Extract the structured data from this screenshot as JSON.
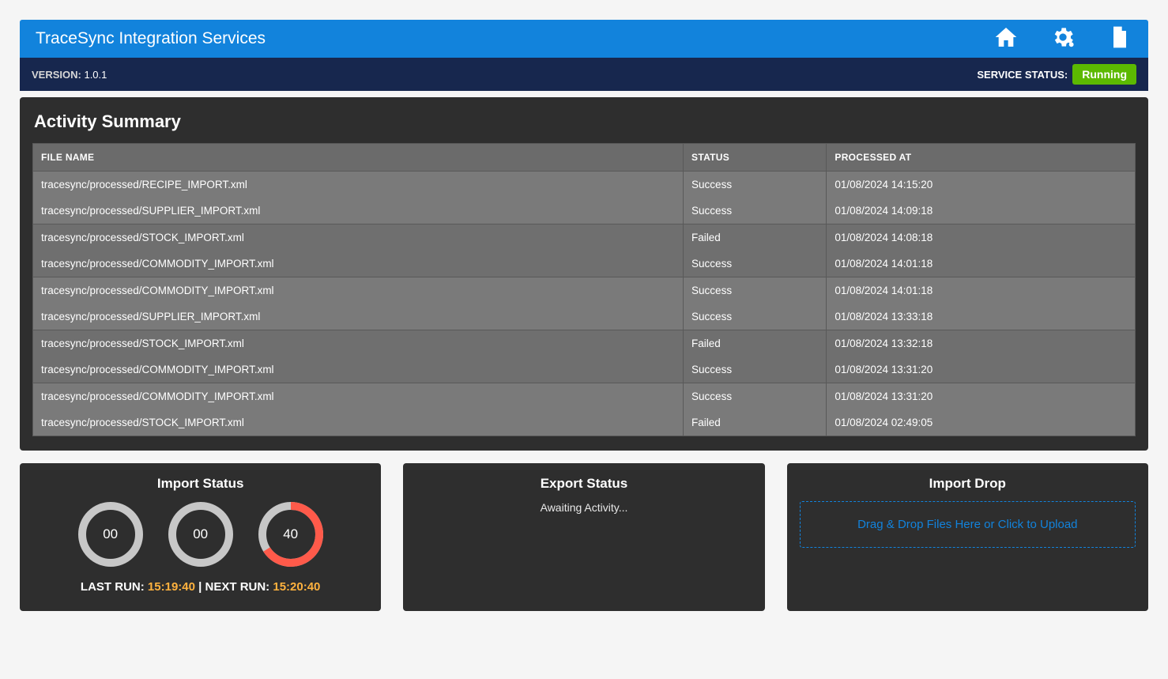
{
  "header": {
    "title": "TraceSync Integration Services",
    "icons": [
      "home",
      "settings",
      "document"
    ]
  },
  "subheader": {
    "version_label": "VERSION:",
    "version_value": "1.0.1",
    "status_label": "SERVICE STATUS:",
    "status_value": "Running"
  },
  "activity": {
    "title": "Activity Summary",
    "columns": {
      "file": "FILE NAME",
      "status": "STATUS",
      "processed": "PROCESSED AT"
    },
    "rows": [
      {
        "file": "tracesync/processed/RECIPE_IMPORT.xml",
        "status": "Success",
        "processed": "01/08/2024 14:15:20"
      },
      {
        "file": "tracesync/processed/SUPPLIER_IMPORT.xml",
        "status": "Success",
        "processed": "01/08/2024 14:09:18"
      },
      {
        "file": "tracesync/processed/STOCK_IMPORT.xml",
        "status": "Failed",
        "processed": "01/08/2024 14:08:18"
      },
      {
        "file": "tracesync/processed/COMMODITY_IMPORT.xml",
        "status": "Success",
        "processed": "01/08/2024 14:01:18"
      },
      {
        "file": "tracesync/processed/COMMODITY_IMPORT.xml",
        "status": "Success",
        "processed": "01/08/2024 14:01:18"
      },
      {
        "file": "tracesync/processed/SUPPLIER_IMPORT.xml",
        "status": "Success",
        "processed": "01/08/2024 13:33:18"
      },
      {
        "file": "tracesync/processed/STOCK_IMPORT.xml",
        "status": "Failed",
        "processed": "01/08/2024 13:32:18"
      },
      {
        "file": "tracesync/processed/COMMODITY_IMPORT.xml",
        "status": "Success",
        "processed": "01/08/2024 13:31:20"
      },
      {
        "file": "tracesync/processed/COMMODITY_IMPORT.xml",
        "status": "Success",
        "processed": "01/08/2024 13:31:20"
      },
      {
        "file": "tracesync/processed/STOCK_IMPORT.xml",
        "status": "Failed",
        "processed": "01/08/2024 02:49:05"
      }
    ]
  },
  "import_status": {
    "title": "Import Status",
    "gauges": [
      {
        "value": "00",
        "pct": 0
      },
      {
        "value": "00",
        "pct": 0
      },
      {
        "value": "40",
        "pct": 66
      }
    ],
    "last_run_label": "LAST RUN:",
    "last_run_time": "15:19:40",
    "sep": " | ",
    "next_run_label": "NEXT RUN:",
    "next_run_time": "15:20:40"
  },
  "export_status": {
    "title": "Export Status",
    "message": "Awaiting Activity..."
  },
  "import_drop": {
    "title": "Import Drop",
    "dropzone_text": "Drag & Drop Files Here or Click to Upload"
  }
}
